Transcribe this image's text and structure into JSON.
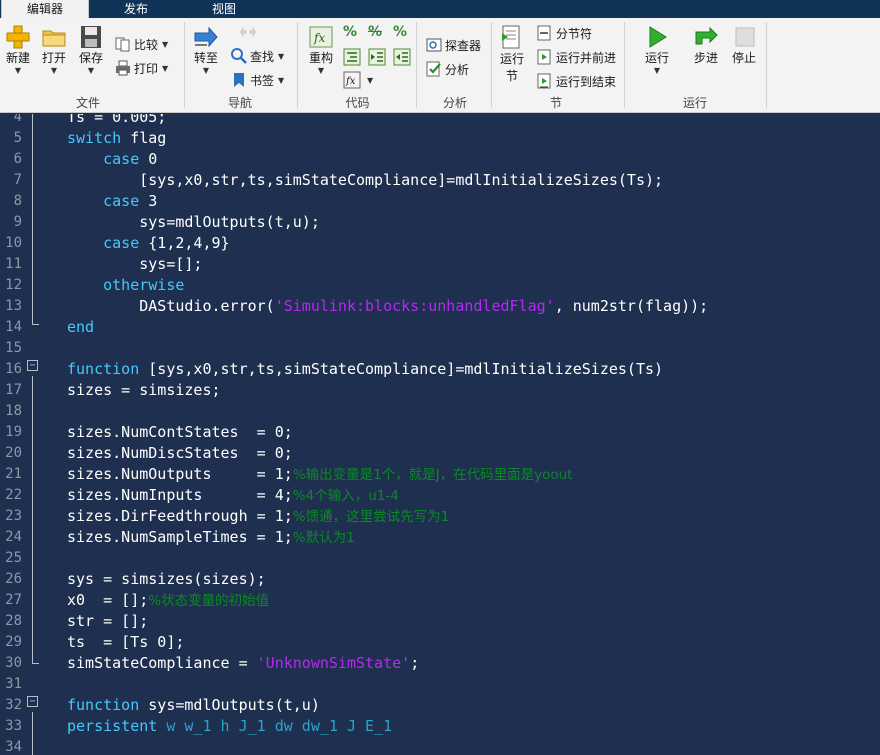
{
  "tabs": [
    "编辑器",
    "发布",
    "视图"
  ],
  "ribbon": {
    "file": {
      "label": "文件",
      "new": "新建",
      "open": "打开",
      "save": "保存",
      "compare": "比较",
      "print": "打印"
    },
    "navigate": {
      "label": "导航",
      "goto": "转至",
      "find": "查找",
      "bookmark": "书签"
    },
    "code": {
      "label": "代码",
      "refactor": "重构",
      "percent_a": "%",
      "percent_b": "%",
      "percent_c": "%"
    },
    "analyze": {
      "label": "分析",
      "inspector": "探查器",
      "analyze": "分析"
    },
    "section": {
      "label": "节",
      "run_section": "运行节",
      "section_break": "分节符",
      "run_advance": "运行并前进",
      "run_to_end": "运行到结束"
    },
    "run": {
      "label": "运行",
      "run": "运行",
      "step": "步进",
      "stop": "停止"
    }
  },
  "code_lines": [
    {
      "n": "4",
      "segs": [
        {
          "t": "Ts = 0.005;",
          "c": ""
        }
      ]
    },
    {
      "n": "5",
      "segs": [
        {
          "t": "switch",
          "c": "kw"
        },
        {
          "t": " flag",
          "c": ""
        }
      ]
    },
    {
      "n": "6",
      "segs": [
        {
          "t": "    ",
          "c": ""
        },
        {
          "t": "case",
          "c": "kw"
        },
        {
          "t": " 0",
          "c": ""
        }
      ]
    },
    {
      "n": "7",
      "segs": [
        {
          "t": "        [sys,x0,str,ts,simStateCompliance]=mdlInitializeSizes(Ts);",
          "c": ""
        }
      ]
    },
    {
      "n": "8",
      "segs": [
        {
          "t": "    ",
          "c": ""
        },
        {
          "t": "case",
          "c": "kw"
        },
        {
          "t": " 3",
          "c": ""
        }
      ]
    },
    {
      "n": "9",
      "segs": [
        {
          "t": "        sys=mdlOutputs(t,u);",
          "c": ""
        }
      ]
    },
    {
      "n": "10",
      "segs": [
        {
          "t": "    ",
          "c": ""
        },
        {
          "t": "case",
          "c": "kw"
        },
        {
          "t": " {1,2,4,9}",
          "c": ""
        }
      ]
    },
    {
      "n": "11",
      "segs": [
        {
          "t": "        sys=[];",
          "c": ""
        }
      ]
    },
    {
      "n": "12",
      "segs": [
        {
          "t": "    ",
          "c": ""
        },
        {
          "t": "otherwise",
          "c": "kw"
        }
      ]
    },
    {
      "n": "13",
      "segs": [
        {
          "t": "        DAStudio.error(",
          "c": ""
        },
        {
          "t": "'Simulink:blocks:unhandledFlag'",
          "c": "str"
        },
        {
          "t": ", num2str(flag));",
          "c": ""
        }
      ]
    },
    {
      "n": "14",
      "segs": [
        {
          "t": "end",
          "c": "kw"
        }
      ]
    },
    {
      "n": "15",
      "segs": []
    },
    {
      "n": "16",
      "segs": [
        {
          "t": "function",
          "c": "kw"
        },
        {
          "t": " [sys,x0,str,ts,simStateCompliance]=mdlInitializeSizes(Ts)",
          "c": ""
        }
      ]
    },
    {
      "n": "17",
      "segs": [
        {
          "t": "sizes = simsizes;",
          "c": ""
        }
      ]
    },
    {
      "n": "18",
      "segs": []
    },
    {
      "n": "19",
      "segs": [
        {
          "t": "sizes.NumContStates  = 0;",
          "c": ""
        }
      ]
    },
    {
      "n": "20",
      "segs": [
        {
          "t": "sizes.NumDiscStates  = 0;",
          "c": ""
        }
      ]
    },
    {
      "n": "21",
      "segs": [
        {
          "t": "sizes.NumOutputs     = 1;",
          "c": ""
        },
        {
          "t": "%输出变量是1个，就是J，在代码里面是yoout",
          "c": "cmt"
        }
      ]
    },
    {
      "n": "22",
      "segs": [
        {
          "t": "sizes.NumInputs      = 4;",
          "c": ""
        },
        {
          "t": "%4个输入，u1-4",
          "c": "cmt"
        }
      ]
    },
    {
      "n": "23",
      "segs": [
        {
          "t": "sizes.DirFeedthrough = 1;",
          "c": ""
        },
        {
          "t": "%馈通，这里尝试先写为1",
          "c": "cmt"
        }
      ]
    },
    {
      "n": "24",
      "segs": [
        {
          "t": "sizes.NumSampleTimes = 1;",
          "c": ""
        },
        {
          "t": "%默认为1",
          "c": "cmt"
        }
      ]
    },
    {
      "n": "25",
      "segs": []
    },
    {
      "n": "26",
      "segs": [
        {
          "t": "sys = simsizes(sizes);",
          "c": ""
        }
      ]
    },
    {
      "n": "27",
      "segs": [
        {
          "t": "x0  = [];",
          "c": ""
        },
        {
          "t": "%状态变量的初始值",
          "c": "cmt"
        }
      ]
    },
    {
      "n": "28",
      "segs": [
        {
          "t": "str = [];",
          "c": ""
        }
      ]
    },
    {
      "n": "29",
      "segs": [
        {
          "t": "ts  = [Ts 0];",
          "c": ""
        }
      ]
    },
    {
      "n": "30",
      "segs": [
        {
          "t": "simStateCompliance = ",
          "c": ""
        },
        {
          "t": "'UnknownSimState'",
          "c": "str"
        },
        {
          "t": ";",
          "c": ""
        }
      ]
    },
    {
      "n": "31",
      "segs": []
    },
    {
      "n": "32",
      "segs": [
        {
          "t": "function",
          "c": "kw"
        },
        {
          "t": " sys=mdlOutputs(t,u)",
          "c": ""
        }
      ]
    },
    {
      "n": "33",
      "segs": [
        {
          "t": "persistent",
          "c": "kw"
        },
        {
          "t": " w w_1 h J_1 dw dw_1 J E_1",
          "c": "per"
        }
      ]
    },
    {
      "n": "34",
      "segs": []
    }
  ],
  "fold_markers": {
    "collapse_symbol": "−"
  },
  "colors": {
    "editor_bg": "#1e2f4f",
    "keyword": "#46c8ff",
    "string": "#b42bf0",
    "comment": "#0a8a24",
    "tab_bar": "#0f3457"
  }
}
